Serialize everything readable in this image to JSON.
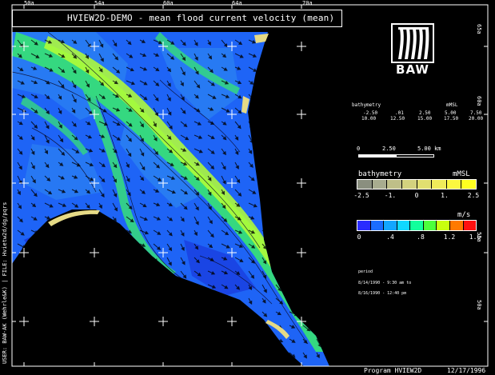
{
  "title": "HVIEW2D-DEMO - mean flood current velocity (mean)",
  "top_ticks": [
    "50a",
    "54a",
    "60a",
    "64a",
    "70a"
  ],
  "right_ticks": [
    "65a",
    "60a",
    "55a",
    "50a"
  ],
  "left_label": "USER: BAW-AK (Wehrle&K) | FILE: Hvietw2d/dg/pqrs",
  "logo": {
    "text": "BAW"
  },
  "bathymetry_header": {
    "label": "bathymetry",
    "unit": "mMSL"
  },
  "bathymetry_rows": [
    [
      "-2.50",
      ".01",
      "2.50",
      "5.00",
      "7.50"
    ],
    [
      "10.00",
      "12.50",
      "15.00",
      "17.50",
      "20.00"
    ]
  ],
  "scale": {
    "ticks": [
      "0",
      "2.50",
      "5.00 km"
    ]
  },
  "bathymetry_legend": {
    "label": "bathymetry",
    "unit": "mMSL",
    "ticks": [
      "-2.5",
      "-1.",
      "0",
      "1.",
      "2.5"
    ],
    "colors": [
      "#8a8f7f",
      "#a8ac8f",
      "#bfbf88",
      "#d3d27e",
      "#e1df70",
      "#efeb5a",
      "#fbf740",
      "#ffff20"
    ]
  },
  "velocity_legend": {
    "unit": "m/s",
    "ticks": [
      "0",
      ".4",
      ".8",
      "1.2",
      "1.6"
    ],
    "colors": [
      "#2a2cff",
      "#1a6dff",
      "#12a6ff",
      "#10d8ff",
      "#12ff9c",
      "#4cff3c",
      "#c8ff10",
      "#ff7a00",
      "#ff1010"
    ]
  },
  "period": {
    "header": "period",
    "from": "8/14/1990 - 9:30 am to",
    "to": "8/16/1990 - 12:40 pm"
  },
  "footer": {
    "program": "Program  HVIEW2D",
    "date": "12/17/1996"
  },
  "colors": {
    "background": "#000000",
    "water_deep": "#1f5bff",
    "water_main": "#1c6cf4",
    "channel": "#39e07a",
    "channel_fast": "#b8ff2a",
    "sand": "#e8dc88"
  }
}
